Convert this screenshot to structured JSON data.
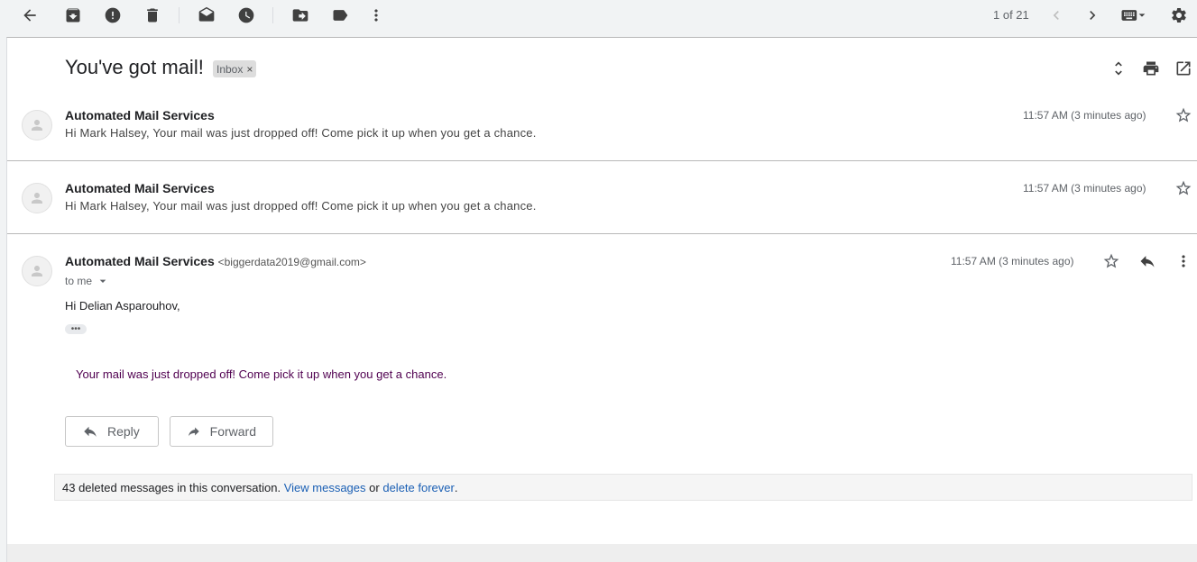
{
  "toolbar": {
    "pager": "1 of 21",
    "icons": [
      "back-arrow-icon",
      "archive-icon",
      "report-spam-icon",
      "delete-icon",
      "mark-unread-icon",
      "snooze-icon",
      "move-to-icon",
      "label-icon",
      "more-vert-icon",
      "prev-icon",
      "next-icon",
      "keyboard-icon",
      "settings-icon"
    ]
  },
  "thread": {
    "subject": "You've got mail!",
    "label": "Inbox",
    "label_close": "×"
  },
  "messages": [
    {
      "sender": "Automated Mail Services",
      "snippet": "Hi Mark Halsey, Your mail was just dropped off! Come pick it up when you get a chance.",
      "time": "11:57 AM (3 minutes ago)"
    },
    {
      "sender": "Automated Mail Services",
      "snippet": "Hi Mark Halsey, Your mail was just dropped off! Come pick it up when you get a chance.",
      "time": "11:57 AM (3 minutes ago)"
    }
  ],
  "open_message": {
    "sender": "Automated Mail Services",
    "email": "<biggerdata2019@gmail.com>",
    "time": "11:57 AM (3 minutes ago)",
    "to": "to me",
    "greeting": "Hi Delian Asparouhov,",
    "ellipsis": "•••",
    "body": "Your mail was just dropped off! Come pick it up when you get a chance.",
    "reply_label": "Reply",
    "forward_label": "Forward"
  },
  "deleted": {
    "text": "43 deleted messages in this conversation.",
    "view_link": "View messages",
    "or_text": "or",
    "delete_link": "delete forever",
    "period": "."
  }
}
